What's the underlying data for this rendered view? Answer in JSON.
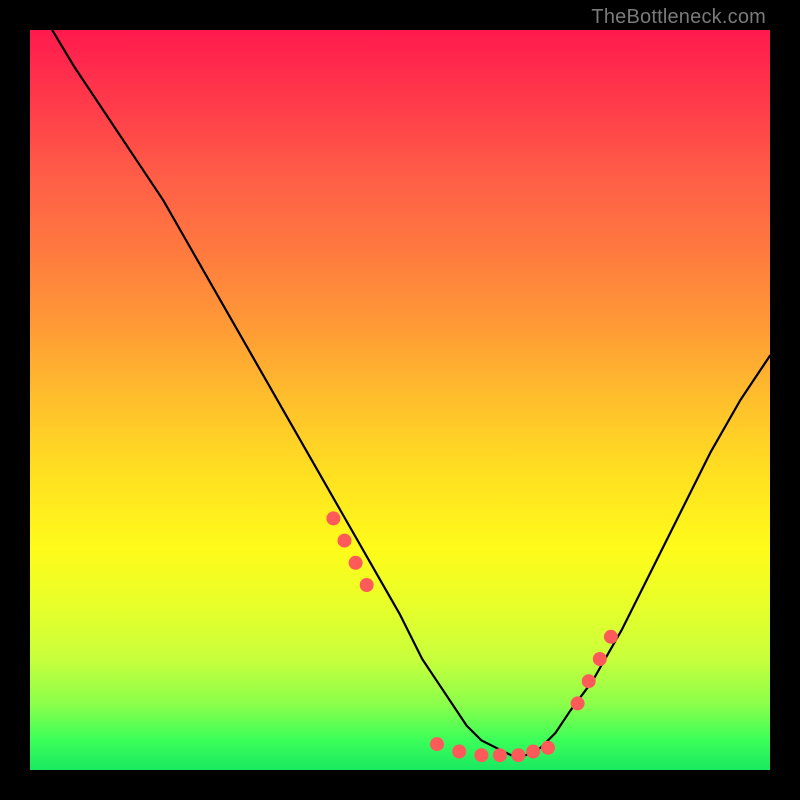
{
  "watermark": "TheBottleneck.com",
  "chart_data": {
    "type": "line",
    "title": "",
    "xlabel": "",
    "ylabel": "",
    "xlim": [
      0,
      100
    ],
    "ylim": [
      0,
      100
    ],
    "curve": {
      "name": "bottleneck-curve",
      "color": "#000000",
      "x": [
        3,
        6,
        10,
        14,
        18,
        22,
        26,
        30,
        34,
        38,
        42,
        46,
        50,
        53,
        55,
        57,
        59,
        61,
        63,
        65,
        67,
        69,
        71,
        73,
        76,
        80,
        84,
        88,
        92,
        96,
        100
      ],
      "y": [
        100,
        95,
        89,
        83,
        77,
        70,
        63,
        56,
        49,
        42,
        35,
        28,
        21,
        15,
        12,
        9,
        6,
        4,
        3,
        2,
        2,
        3,
        5,
        8,
        12,
        19,
        27,
        35,
        43,
        50,
        56
      ]
    },
    "markers": {
      "name": "highlight-dots",
      "color": "#ff5a5a",
      "radius": 7,
      "x": [
        41,
        42.5,
        44,
        45.5,
        55,
        58,
        61,
        63.5,
        66,
        68,
        70,
        74,
        75.5,
        77,
        78.5
      ],
      "y": [
        34,
        31,
        28,
        25,
        3.5,
        2.5,
        2,
        2,
        2,
        2.5,
        3,
        9,
        12,
        15,
        18
      ]
    },
    "gradient_stops": [
      {
        "pos": 0,
        "color": "#ff1a4d"
      },
      {
        "pos": 10,
        "color": "#ff3b4a"
      },
      {
        "pos": 20,
        "color": "#ff5e47"
      },
      {
        "pos": 30,
        "color": "#ff7a3f"
      },
      {
        "pos": 40,
        "color": "#ff9a36"
      },
      {
        "pos": 50,
        "color": "#ffbf2c"
      },
      {
        "pos": 60,
        "color": "#ffe021"
      },
      {
        "pos": 70,
        "color": "#fffb1a"
      },
      {
        "pos": 78,
        "color": "#e6ff2a"
      },
      {
        "pos": 85,
        "color": "#c8ff3c"
      },
      {
        "pos": 91,
        "color": "#8cff4a"
      },
      {
        "pos": 96,
        "color": "#3bff5a"
      },
      {
        "pos": 100,
        "color": "#19e860"
      }
    ]
  }
}
